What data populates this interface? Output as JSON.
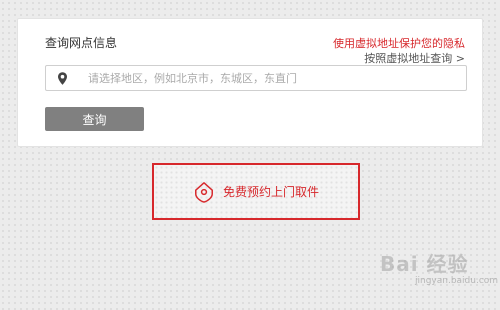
{
  "form": {
    "title": "查询网点信息",
    "privacy_link": "使用虚拟地址保护您的隐私",
    "address_query_link": "按照虚拟地址查询 >",
    "search_placeholder": "请选择地区，例如北京市，东城区，东直门",
    "query_button": "查询"
  },
  "pickup": {
    "label": "免费预约上门取件"
  },
  "watermark": {
    "text": "Bai 经验",
    "sub": "jingyan.baidu.com"
  },
  "colors": {
    "accent_red": "#d7282c",
    "button_gray": "#808080"
  }
}
